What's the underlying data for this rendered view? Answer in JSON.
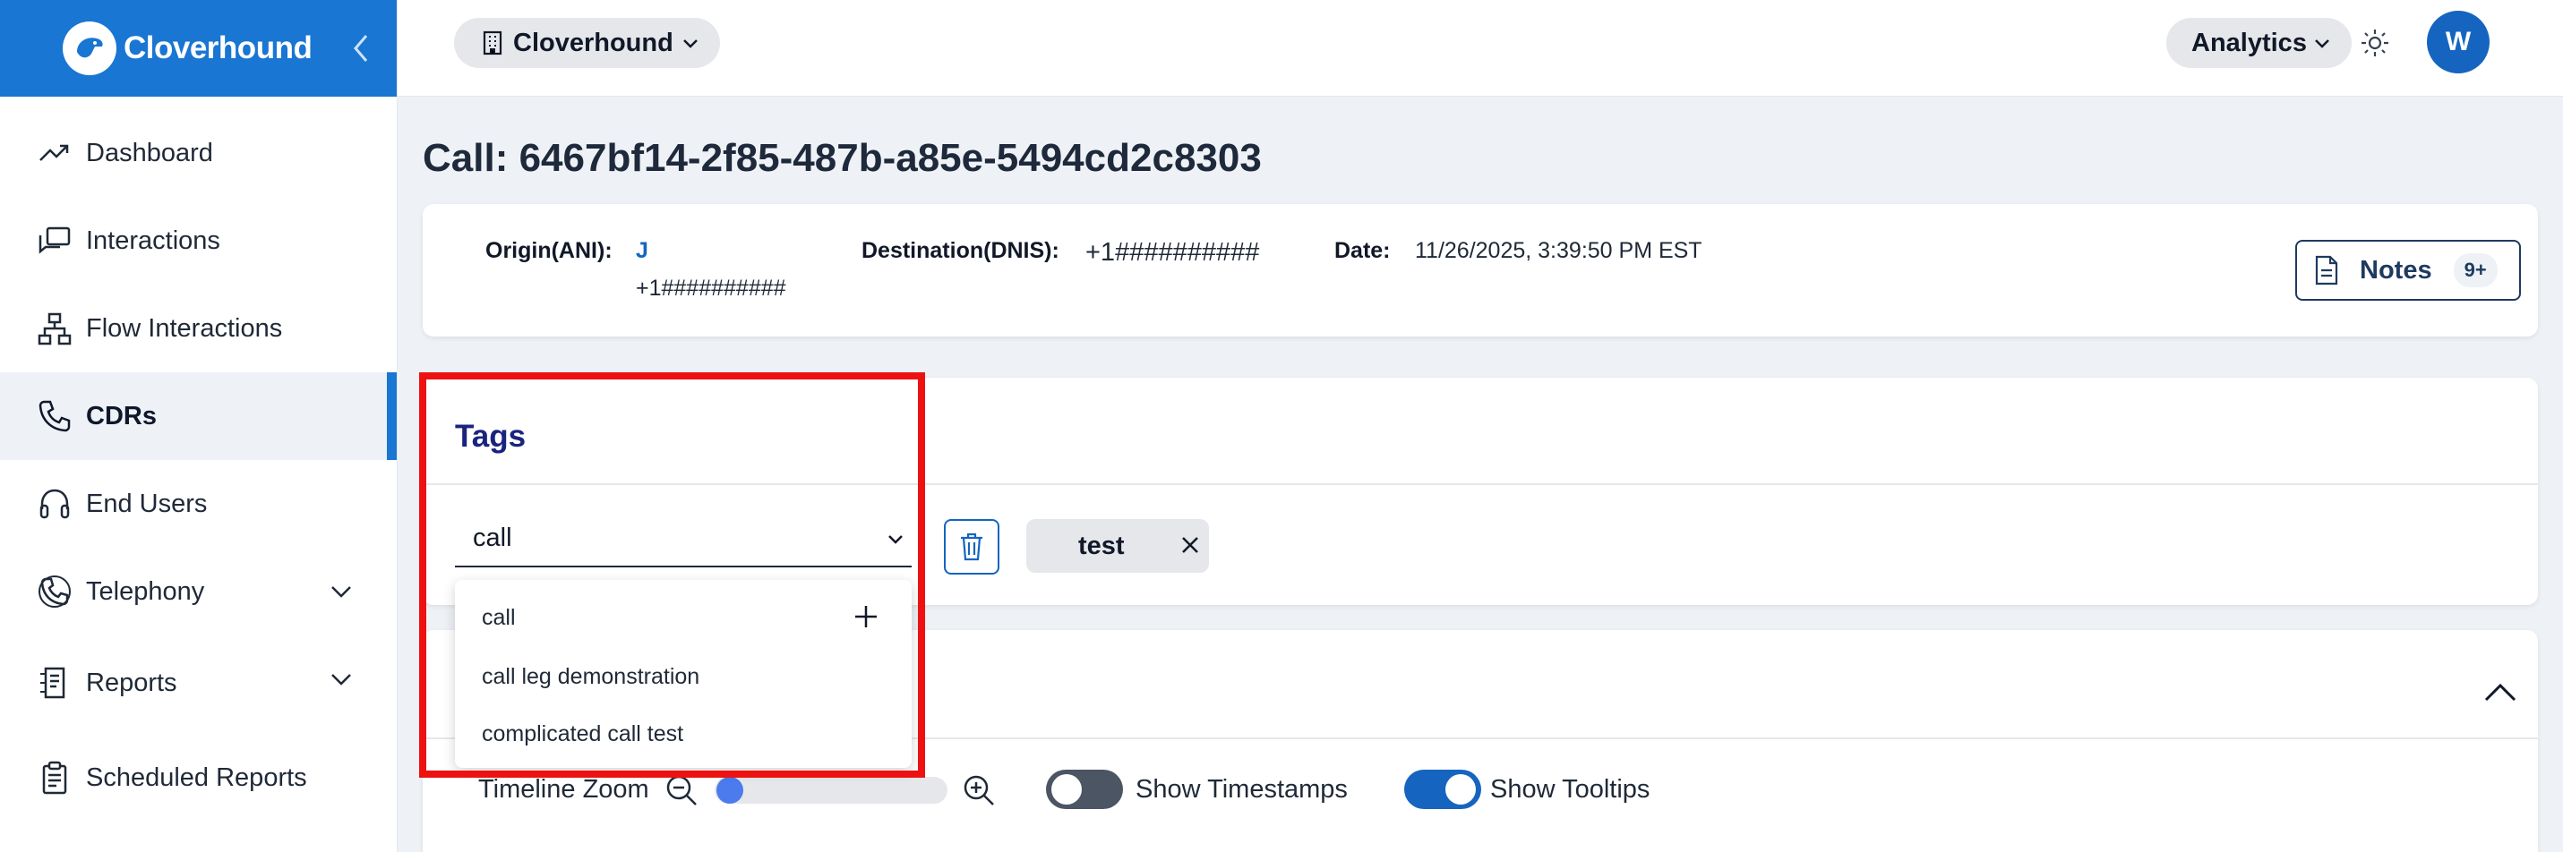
{
  "brand": {
    "name": "Cloverhound"
  },
  "sidebar": {
    "items": [
      {
        "label": "Dashboard",
        "icon": "trending-up-icon"
      },
      {
        "label": "Interactions",
        "icon": "chat-icon"
      },
      {
        "label": "Flow Interactions",
        "icon": "flow-icon"
      },
      {
        "label": "CDRs",
        "icon": "phone-icon",
        "active": true
      },
      {
        "label": "End Users",
        "icon": "headset-icon"
      },
      {
        "label": "Telephony",
        "icon": "phone-ring-icon"
      },
      {
        "label": "Reports",
        "icon": "report-icon"
      },
      {
        "label": "Scheduled Reports",
        "icon": "clipboard-icon"
      }
    ]
  },
  "header": {
    "org": "Cloverhound",
    "analytics": "Analytics",
    "avatar_initial": "W"
  },
  "page": {
    "title": "Call: 6467bf14-2f85-487b-a85e-5494cd2c8303"
  },
  "call_info": {
    "origin_label": "Origin(ANI):",
    "origin_name": "J",
    "origin_number": "+1##########",
    "destination_label": "Destination(DNIS):",
    "destination_value": "+1##########",
    "date_label": "Date:",
    "date_value": "11/26/2025, 3:39:50 PM EST",
    "notes_label": "Notes",
    "notes_count": "9+"
  },
  "tags": {
    "title": "Tags",
    "input_value": "call",
    "chips": [
      "test"
    ],
    "dropdown_options": [
      "call",
      "call leg demonstration",
      "complicated call test"
    ]
  },
  "timeline": {
    "zoom_label": "Timeline Zoom",
    "zoom_level": 0,
    "show_timestamps_label": "Show Timestamps",
    "show_timestamps": false,
    "show_tooltips_label": "Show Tooltips",
    "show_tooltips": true
  },
  "colors": {
    "brand": "#1976d2",
    "highlight": "#ee1111",
    "tags_title": "#1a237e"
  }
}
